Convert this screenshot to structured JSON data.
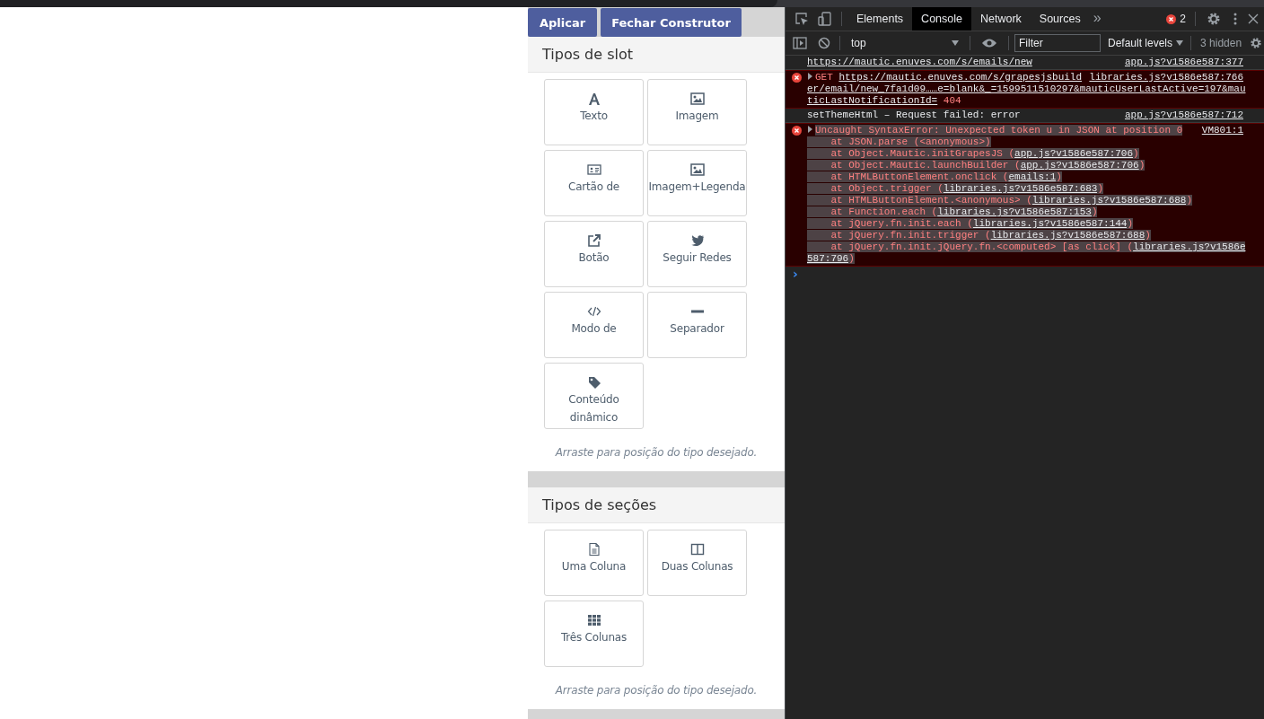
{
  "builder": {
    "buttons": [
      {
        "label": "Aplicar"
      },
      {
        "label": "Fechar Construtor"
      }
    ],
    "sections": [
      {
        "title": "Tipos de slot",
        "hint": "Arraste para posição do tipo desejado.",
        "blocks": [
          {
            "kind": "letter",
            "label": "Texto"
          },
          {
            "kind": "image",
            "label": "Imagem"
          },
          {
            "kind": "card",
            "label": "Cartão de"
          },
          {
            "kind": "image",
            "label": "Imagem+Legenda"
          },
          {
            "kind": "external",
            "label": "Botão"
          },
          {
            "kind": "bird",
            "label": "Seguir Redes"
          },
          {
            "kind": "code",
            "label": "Modo de"
          },
          {
            "kind": "dash",
            "label": "Separador"
          },
          {
            "kind": "tag",
            "label": "Conteúdo dinâmico"
          }
        ]
      },
      {
        "title": "Tipos de seções",
        "hint": "Arraste para posição do tipo desejado.",
        "blocks": [
          {
            "kind": "doc",
            "label": "Uma Coluna"
          },
          {
            "kind": "columns",
            "label": "Duas Colunas"
          },
          {
            "kind": "grid",
            "label": "Três Colunas"
          }
        ]
      }
    ]
  },
  "devtools": {
    "tabs": [
      {
        "label": "Elements",
        "selected": false
      },
      {
        "label": "Console",
        "selected": true
      },
      {
        "label": "Network",
        "selected": false
      },
      {
        "label": "Sources",
        "selected": false
      }
    ],
    "more": "»",
    "error_count": "2",
    "context": "top",
    "filter": {
      "placeholder": "Filter"
    },
    "levels": "Default levels",
    "hidden": "3 hidden",
    "messages": [
      {
        "kind": "log",
        "highlighted": false,
        "expander": false,
        "source": "app.js?v1586e587:377",
        "lines": [
          [
            {
              "text": "https://mautic.enuves.com/s/emails/new",
              "link": true
            }
          ]
        ]
      },
      {
        "kind": "error",
        "highlighted": false,
        "expander": true,
        "source": "libraries.js?v1586e587:766",
        "lines": [
          [
            {
              "text": "GET ",
              "link": false
            },
            {
              "text": "https://mautic.enuves.com/s/grapesjsbuild",
              "link": true
            }
          ],
          [
            {
              "text": "er/email/new_7fa1d09……e=blank&_=1599511510297&mauticUserLastActive=197&mau",
              "link": true
            }
          ],
          [
            {
              "text": "ticLastNotificationId=",
              "link": true
            },
            {
              "text": " 404",
              "link": false
            }
          ]
        ]
      },
      {
        "kind": "log",
        "highlighted": false,
        "expander": false,
        "source": "app.js?v1586e587:712",
        "lines": [
          [
            {
              "text": "setThemeHtml – Request failed: error",
              "link": false
            }
          ]
        ]
      },
      {
        "kind": "error",
        "highlighted": true,
        "expander": true,
        "source": "VM801:1",
        "lines": [
          [
            {
              "text": "Uncaught SyntaxError: Unexpected token u in JSON at position 0",
              "link": false
            }
          ],
          [
            {
              "text": "    at JSON.parse (<anonymous>)",
              "link": false
            }
          ],
          [
            {
              "text": "    at Object.Mautic.initGrapesJS (",
              "link": false
            },
            {
              "text": "app.js?v1586e587:706",
              "link": true
            },
            {
              "text": ")",
              "link": false
            }
          ],
          [
            {
              "text": "    at Object.Mautic.launchBuilder (",
              "link": false
            },
            {
              "text": "app.js?v1586e587:706",
              "link": true
            },
            {
              "text": ")",
              "link": false
            }
          ],
          [
            {
              "text": "    at HTMLButtonElement.onclick (",
              "link": false
            },
            {
              "text": "emails:1",
              "link": true
            },
            {
              "text": ")",
              "link": false
            }
          ],
          [
            {
              "text": "    at Object.trigger (",
              "link": false
            },
            {
              "text": "libraries.js?v1586e587:683",
              "link": true
            },
            {
              "text": ")",
              "link": false
            }
          ],
          [
            {
              "text": "    at HTMLButtonElement.<anonymous> (",
              "link": false
            },
            {
              "text": "libraries.js?v1586e587:688",
              "link": true
            },
            {
              "text": ")",
              "link": false
            }
          ],
          [
            {
              "text": "    at Function.each (",
              "link": false
            },
            {
              "text": "libraries.js?v1586e587:153",
              "link": true
            },
            {
              "text": ")",
              "link": false
            }
          ],
          [
            {
              "text": "    at jQuery.fn.init.each (",
              "link": false
            },
            {
              "text": "libraries.js?v1586e587:144",
              "link": true
            },
            {
              "text": ")",
              "link": false
            }
          ],
          [
            {
              "text": "    at jQuery.fn.init.trigger (",
              "link": false
            },
            {
              "text": "libraries.js?v1586e587:688",
              "link": true
            },
            {
              "text": ")",
              "link": false
            }
          ],
          [
            {
              "text": "    at jQuery.fn.init.jQuery.fn.<computed> [as click] (",
              "link": false
            },
            {
              "text": "libraries.js?v1586e",
              "link": true
            }
          ],
          [
            {
              "text": "587:796",
              "link": true
            },
            {
              "text": ")",
              "link": false
            }
          ]
        ]
      }
    ],
    "prompt": "›"
  }
}
